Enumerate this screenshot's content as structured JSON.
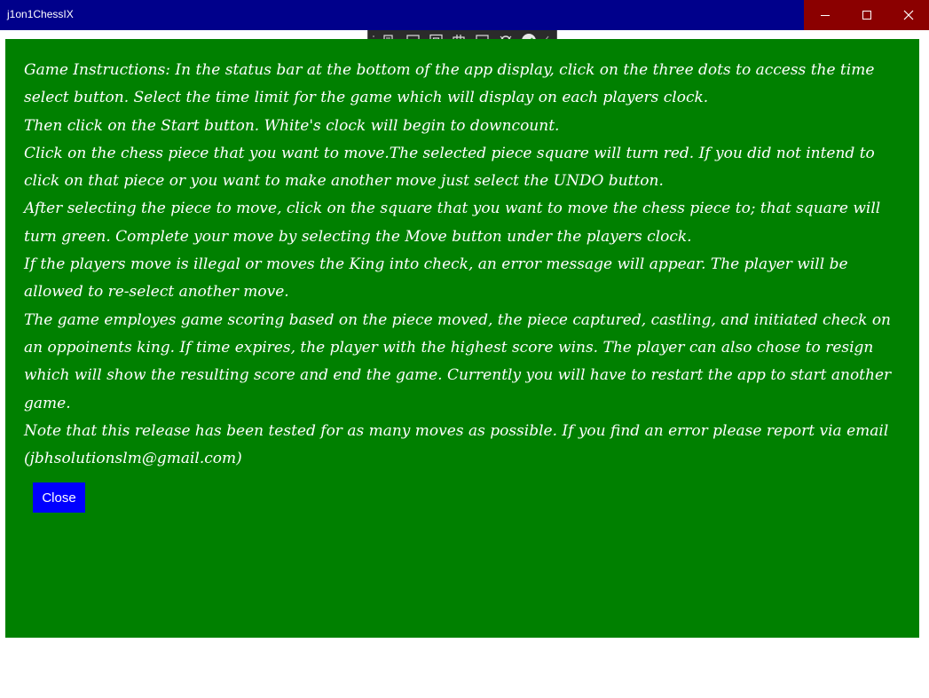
{
  "window": {
    "title": "j1on1ChessIX"
  },
  "debug_toolbar": {
    "icons": [
      "live-visual-tree-icon",
      "select-element-icon",
      "display-layout-adorners-icon",
      "track-focus-icon",
      "hot-reload-icon",
      "accessibility-icon",
      "checkmark-icon",
      "collapse-chevron-icon"
    ]
  },
  "instructions": {
    "paragraphs": [
      "Game Instructions:  In the status bar at the bottom of the app display, click on the three dots to access the time select button. Select the time limit for the game which will display on each players clock.",
      "Then click on the Start button. White's clock will begin to downcount.",
      "Click on the chess piece that you want to move.The selected piece square will turn red. If you did not intend to click on that piece or you want to make another move just select the UNDO button.",
      "After selecting the piece to move, click on the square that you want to move the chess piece to; that square will turn green. Complete your move by selecting the Move button under the players clock.",
      "If the players move is illegal or moves the King into check, an error message will appear. The player will be allowed to re-select another move.",
      "The game employes game scoring based on the piece moved, the piece captured, castling, and initiated check on an oppoinents king. If time expires, the player with the highest score wins. The player can also chose to resign which will show the resulting score and end the game. Currently you will have to restart the app to start another game.",
      "Note that this release has been tested for as many moves as possible. If you find an error please report via email (jbhsolutionslm@gmail.com)"
    ],
    "close_label": "Close"
  },
  "colors": {
    "titlebar": "#00008b",
    "window_controls": "#8b0000",
    "panel": "#008000",
    "close_button": "#0000ff",
    "text": "#ffffff"
  }
}
